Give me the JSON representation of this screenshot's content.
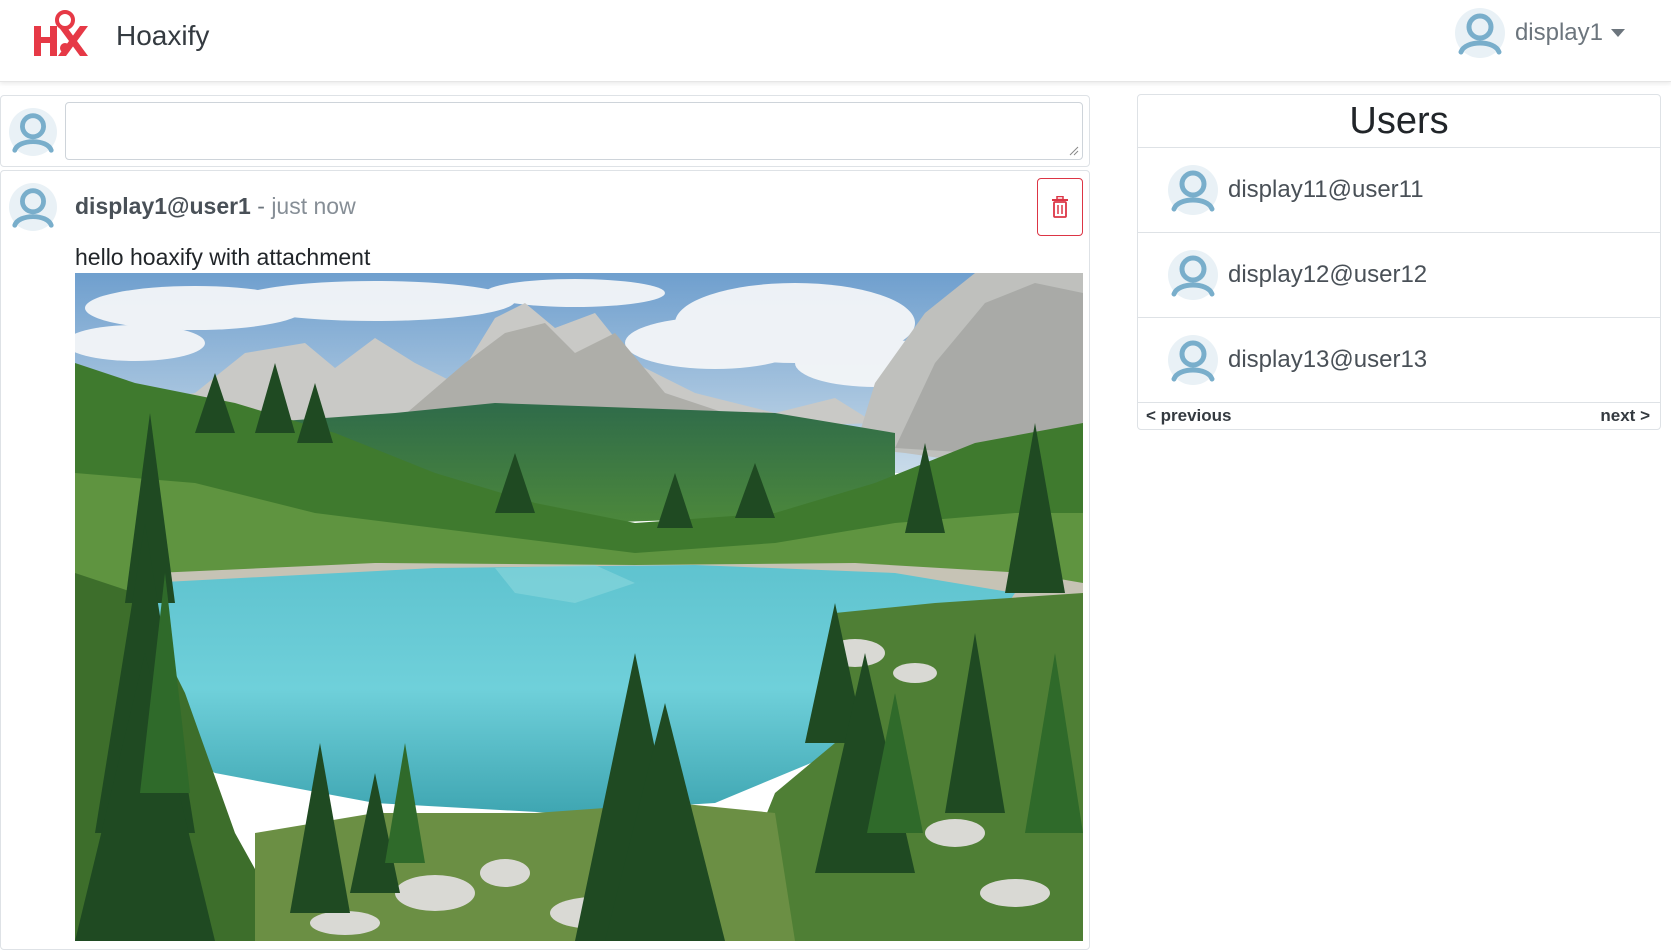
{
  "navbar": {
    "brand_name": "Hoaxify",
    "logo_text": "HX",
    "username": "display1"
  },
  "composer": {
    "placeholder": "",
    "value": ""
  },
  "post": {
    "user": "display1@user1",
    "separator": " - ",
    "time": "just now",
    "content": "hello hoaxify with attachment",
    "attachment_description": "mountain lake landscape photo"
  },
  "users": {
    "title": "Users",
    "items": [
      {
        "label": "display11@user11"
      },
      {
        "label": "display12@user12"
      },
      {
        "label": "display13@user13"
      }
    ],
    "previous": "< previous",
    "next": "next >"
  },
  "colors": {
    "brand_red": "#e63946",
    "danger": "#dc3545",
    "avatar_blue": "#79aecb"
  }
}
